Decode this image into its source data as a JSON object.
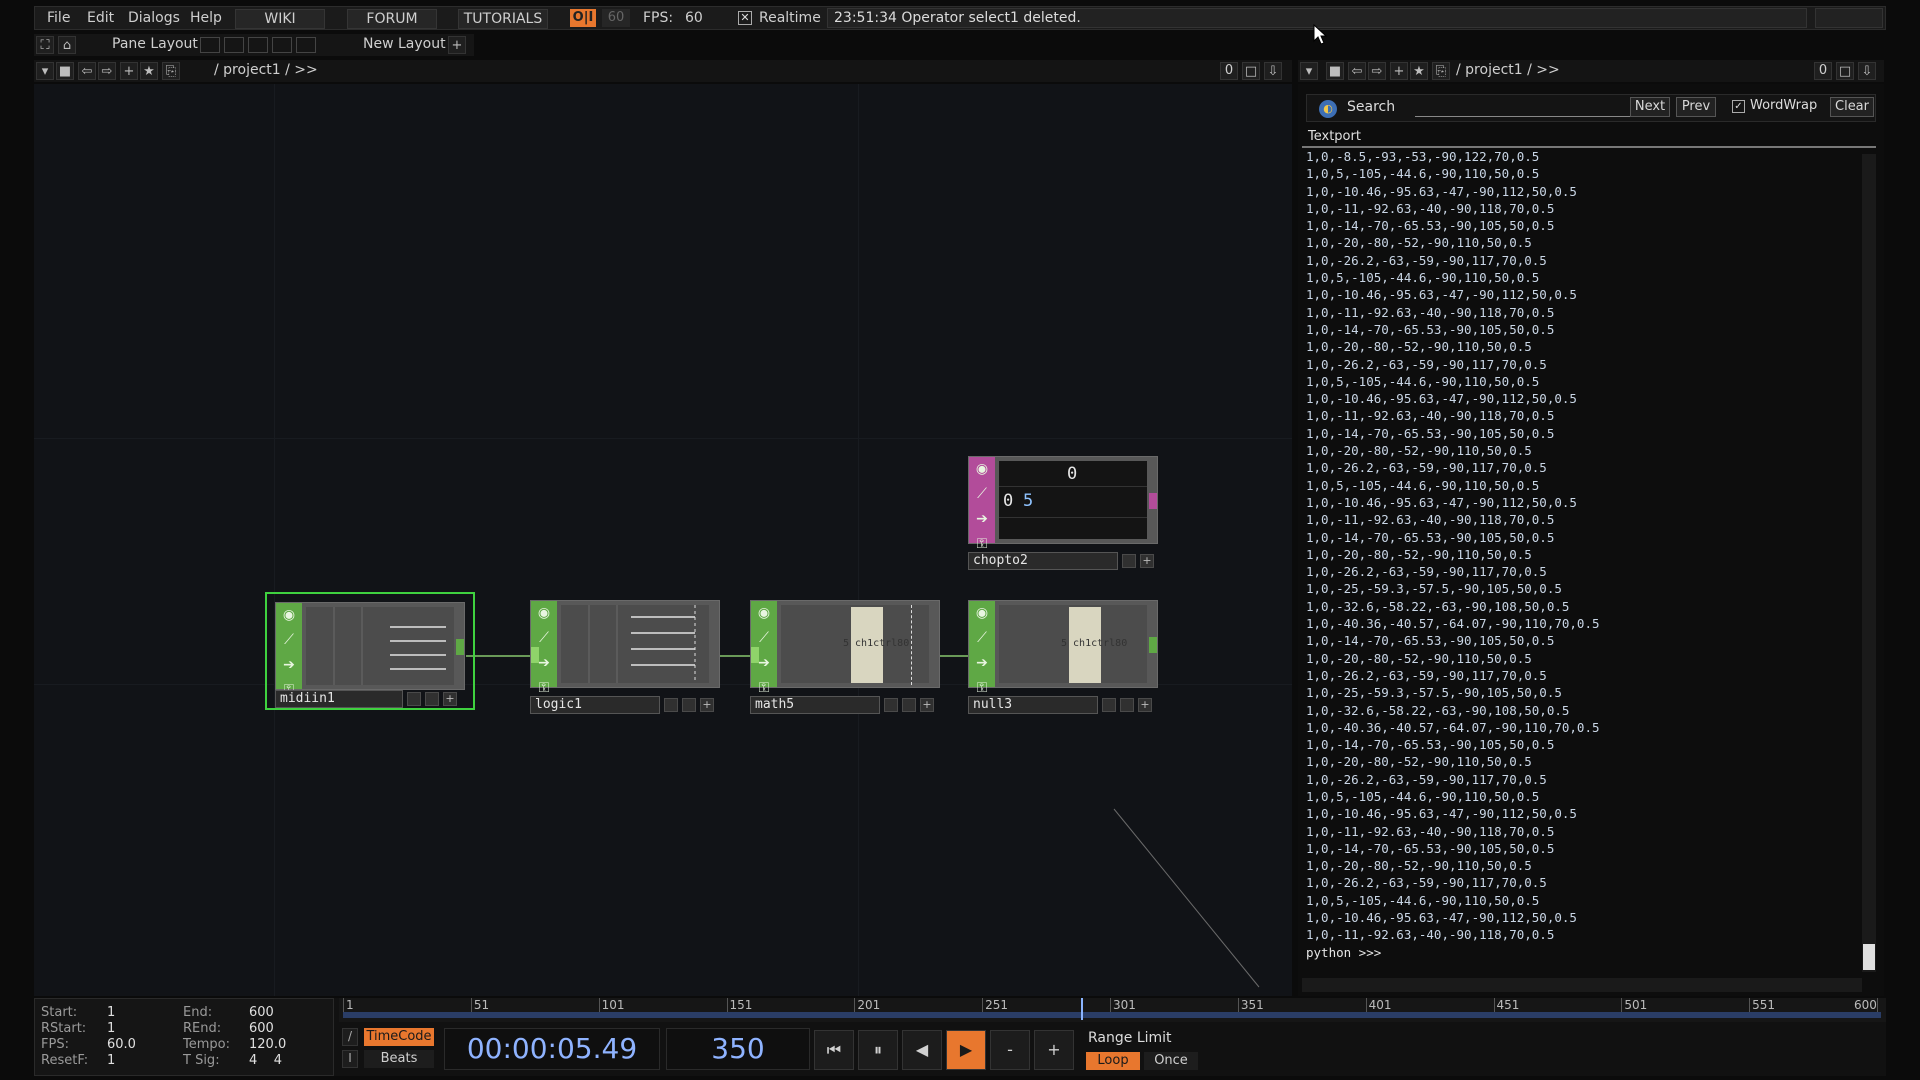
{
  "menubar": {
    "items": [
      "File",
      "Edit",
      "Dialogs",
      "Help"
    ],
    "buttons": [
      "WIKI",
      "FORUM",
      "TUTORIALS"
    ],
    "fps_badge": "60",
    "fps_label": "FPS:",
    "fps_value": "60",
    "realtime_label": "Realtime",
    "realtime_checked": true,
    "status_message": "23:51:34 Operator select1 deleted."
  },
  "layout_bar": {
    "pane_layout": "Pane Layout",
    "new_layout": "New Layout",
    "add": "+"
  },
  "network_nav": {
    "path": "/ project1 / >>",
    "zero": "0"
  },
  "textport_nav": {
    "path": "/ project1 / >>",
    "zero": "0"
  },
  "nodes": [
    {
      "name": "midiin1",
      "selected": true
    },
    {
      "name": "logic1",
      "selected": false
    },
    {
      "name": "math5",
      "selected": false,
      "overlay": "5 ch1ctrl80"
    },
    {
      "name": "null3",
      "selected": false,
      "overlay": "5 ch1ctrl80"
    },
    {
      "name": "chopto2",
      "selected": false,
      "cell_top": "0",
      "cell_row_index": "0",
      "cell_value": "5"
    }
  ],
  "textport": {
    "search_label": "Search",
    "next": "Next",
    "prev": "Prev",
    "wordwrap_label": "WordWrap",
    "wordwrap_checked": true,
    "clear": "Clear",
    "tab": "Textport",
    "prompt": "python >>>",
    "lines": [
      "1,0,-8.5,-93,-53,-90,122,70,0.5",
      "1,0,5,-105,-44.6,-90,110,50,0.5",
      "1,0,-10.46,-95.63,-47,-90,112,50,0.5",
      "1,0,-11,-92.63,-40,-90,118,70,0.5",
      "1,0,-14,-70,-65.53,-90,105,50,0.5",
      "1,0,-20,-80,-52,-90,110,50,0.5",
      "1,0,-26.2,-63,-59,-90,117,70,0.5",
      "1,0,5,-105,-44.6,-90,110,50,0.5",
      "1,0,-10.46,-95.63,-47,-90,112,50,0.5",
      "1,0,-11,-92.63,-40,-90,118,70,0.5",
      "1,0,-14,-70,-65.53,-90,105,50,0.5",
      "1,0,-20,-80,-52,-90,110,50,0.5",
      "1,0,-26.2,-63,-59,-90,117,70,0.5",
      "1,0,5,-105,-44.6,-90,110,50,0.5",
      "1,0,-10.46,-95.63,-47,-90,112,50,0.5",
      "1,0,-11,-92.63,-40,-90,118,70,0.5",
      "1,0,-14,-70,-65.53,-90,105,50,0.5",
      "1,0,-20,-80,-52,-90,110,50,0.5",
      "1,0,-26.2,-63,-59,-90,117,70,0.5",
      "1,0,5,-105,-44.6,-90,110,50,0.5",
      "1,0,-10.46,-95.63,-47,-90,112,50,0.5",
      "1,0,-11,-92.63,-40,-90,118,70,0.5",
      "1,0,-14,-70,-65.53,-90,105,50,0.5",
      "1,0,-20,-80,-52,-90,110,50,0.5",
      "1,0,-26.2,-63,-59,-90,117,70,0.5",
      "1,0,-25,-59.3,-57.5,-90,105,50,0.5",
      "1,0,-32.6,-58.22,-63,-90,108,50,0.5",
      "1,0,-40.36,-40.57,-64.07,-90,110,70,0.5",
      "1,0,-14,-70,-65.53,-90,105,50,0.5",
      "1,0,-20,-80,-52,-90,110,50,0.5",
      "1,0,-26.2,-63,-59,-90,117,70,0.5",
      "1,0,-25,-59.3,-57.5,-90,105,50,0.5",
      "1,0,-32.6,-58.22,-63,-90,108,50,0.5",
      "1,0,-40.36,-40.57,-64.07,-90,110,70,0.5",
      "1,0,-14,-70,-65.53,-90,105,50,0.5",
      "1,0,-20,-80,-52,-90,110,50,0.5",
      "1,0,-26.2,-63,-59,-90,117,70,0.5",
      "1,0,5,-105,-44.6,-90,110,50,0.5",
      "1,0,-10.46,-95.63,-47,-90,112,50,0.5",
      "1,0,-11,-92.63,-40,-90,118,70,0.5",
      "1,0,-14,-70,-65.53,-90,105,50,0.5",
      "1,0,-20,-80,-52,-90,110,50,0.5",
      "1,0,-26.2,-63,-59,-90,117,70,0.5",
      "1,0,5,-105,-44.6,-90,110,50,0.5",
      "1,0,-10.46,-95.63,-47,-90,112,50,0.5",
      "1,0,-11,-92.63,-40,-90,118,70,0.5"
    ]
  },
  "timeline": {
    "settings": [
      {
        "k": "Start:",
        "v": "1"
      },
      {
        "k": "RStart:",
        "v": "1"
      },
      {
        "k": "FPS:",
        "v": "60.0"
      },
      {
        "k": "ResetF:",
        "v": "1"
      },
      {
        "k": "End:",
        "v": "600"
      },
      {
        "k": "REnd:",
        "v": "600"
      },
      {
        "k": "Tempo:",
        "v": "120.0"
      },
      {
        "k": "T Sig:",
        "v": "4    4"
      }
    ],
    "ruler_ticks": [
      "1",
      "51",
      "101",
      "151",
      "201",
      "251",
      "301",
      "351",
      "401",
      "451",
      "501",
      "551",
      "600"
    ],
    "current_frame": "350",
    "timecode": "00:00:05.49",
    "timecode_mode": "TimeCode",
    "beats_mode": "Beats",
    "range_limit": "Range Limit",
    "loop": "Loop",
    "once": "Once",
    "transport": [
      "⏮",
      "⏸",
      "◀",
      "▶",
      "-",
      "+"
    ]
  },
  "colors": {
    "accent": "#e8772e",
    "chop_green": "#5fa845",
    "dat_pink": "#b24c9a",
    "selected_border": "#3fd13f"
  }
}
